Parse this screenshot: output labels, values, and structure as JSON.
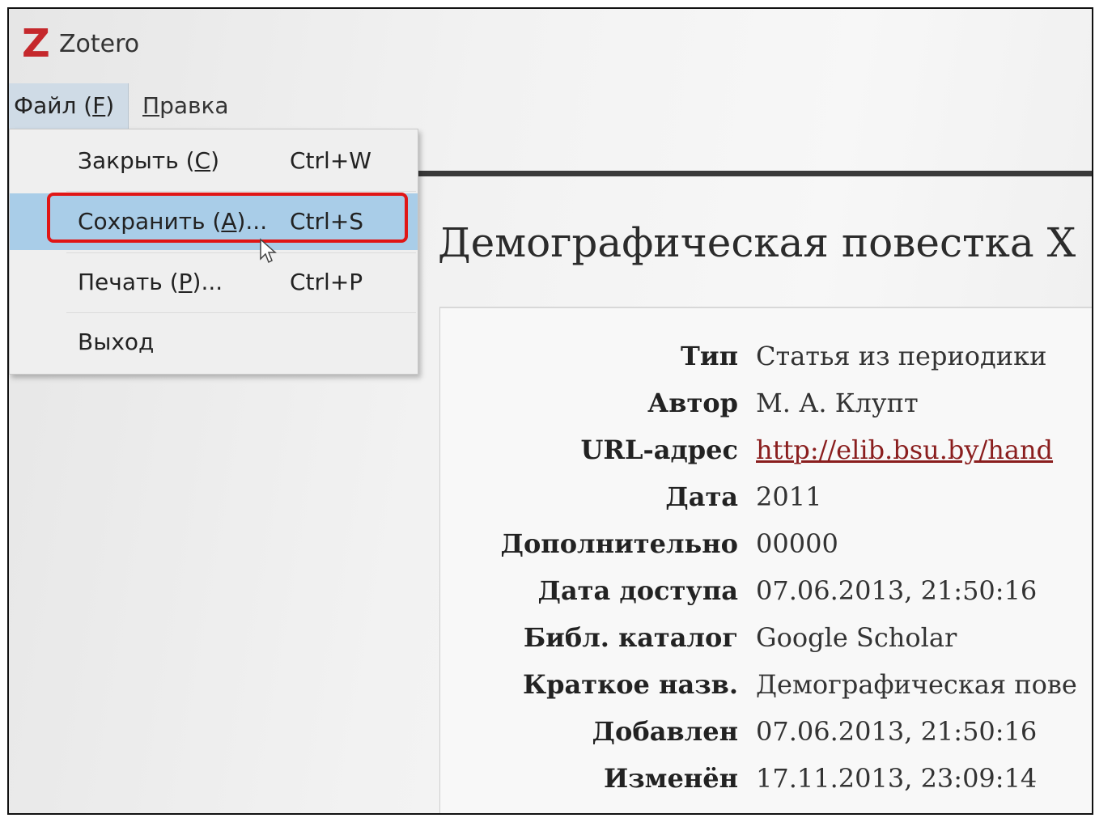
{
  "window": {
    "app_title": "Zotero",
    "logo_letter": "Z",
    "brand_color": "#c5282c"
  },
  "menubar": {
    "file": {
      "label": "Файл",
      "hotkey": "F"
    },
    "edit": {
      "first_letter": "П",
      "rest": "равка"
    }
  },
  "dropdown": {
    "items": [
      {
        "label_pre": "Закрыть (",
        "hotkey": "C",
        "label_post": ")",
        "shortcut": "Ctrl+W"
      },
      {
        "label_pre": "Сохранить (",
        "hotkey": "A",
        "label_post": ")...",
        "shortcut": "Ctrl+S"
      },
      {
        "label_pre": "Печать (",
        "hotkey": "P",
        "label_post": ")...",
        "shortcut": "Ctrl+P"
      },
      {
        "label_pre": "Выход",
        "hotkey": "",
        "label_post": "",
        "shortcut": ""
      }
    ],
    "highlight_color": "#a9cde8",
    "callout_color": "#e01616"
  },
  "document": {
    "title": "Демографическая повестка Х",
    "fields": [
      {
        "key": "Тип",
        "value": "Статья из периодики"
      },
      {
        "key": "Автор",
        "value": "М. А. Клупт"
      },
      {
        "key": "URL-адрес",
        "value": "http://elib.bsu.by/hand"
      },
      {
        "key": "Дата",
        "value": "2011"
      },
      {
        "key": "Дополнительно",
        "value": "00000"
      },
      {
        "key": "Дата доступа",
        "value": "07.06.2013, 21:50:16"
      },
      {
        "key": "Библ. каталог",
        "value": "Google Scholar"
      },
      {
        "key": "Краткое назв.",
        "value": "Демографическая пове"
      },
      {
        "key": "Добавлен",
        "value": "07.06.2013, 21:50:16"
      },
      {
        "key": "Изменён",
        "value": "17.11.2013, 23:09:14"
      }
    ]
  }
}
